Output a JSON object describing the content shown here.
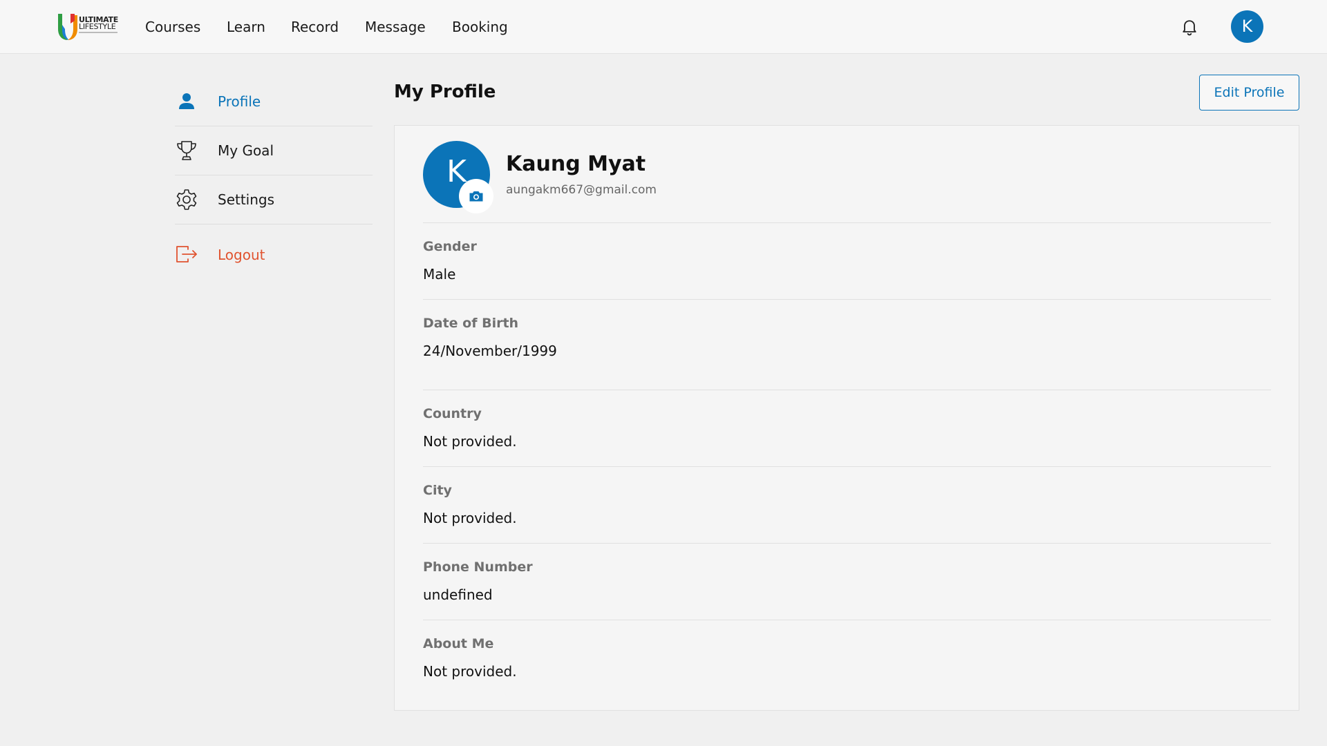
{
  "brand": {
    "logo_line1": "ULTIMATE",
    "logo_line2": "LIFESTYLE"
  },
  "nav": {
    "items": [
      "Courses",
      "Learn",
      "Record",
      "Message",
      "Booking"
    ]
  },
  "header": {
    "avatar_initial": "K",
    "notification_icon": "bell-icon"
  },
  "sidebar": {
    "items": [
      {
        "label": "Profile",
        "icon": "user-icon",
        "active": true
      },
      {
        "label": "My Goal",
        "icon": "trophy-icon",
        "active": false
      },
      {
        "label": "Settings",
        "icon": "gear-icon",
        "active": false
      }
    ],
    "logout_label": "Logout",
    "logout_icon": "logout-icon"
  },
  "main": {
    "title": "My Profile",
    "edit_button": "Edit Profile"
  },
  "profile": {
    "avatar_initial": "K",
    "name": "Kaung Myat",
    "email": "aungakm667@gmail.com",
    "fields": [
      {
        "label": "Gender",
        "value": "Male"
      },
      {
        "label": "Date of Birth",
        "value": "24/November/1999"
      },
      {
        "label": "Country",
        "value": "Not provided."
      },
      {
        "label": "City",
        "value": "Not provided."
      },
      {
        "label": "Phone Number",
        "value": "undefined"
      },
      {
        "label": "About Me",
        "value": "Not provided."
      }
    ]
  },
  "colors": {
    "accent": "#0b74b8",
    "logout": "#e0532f",
    "background": "#f0f0f0"
  }
}
